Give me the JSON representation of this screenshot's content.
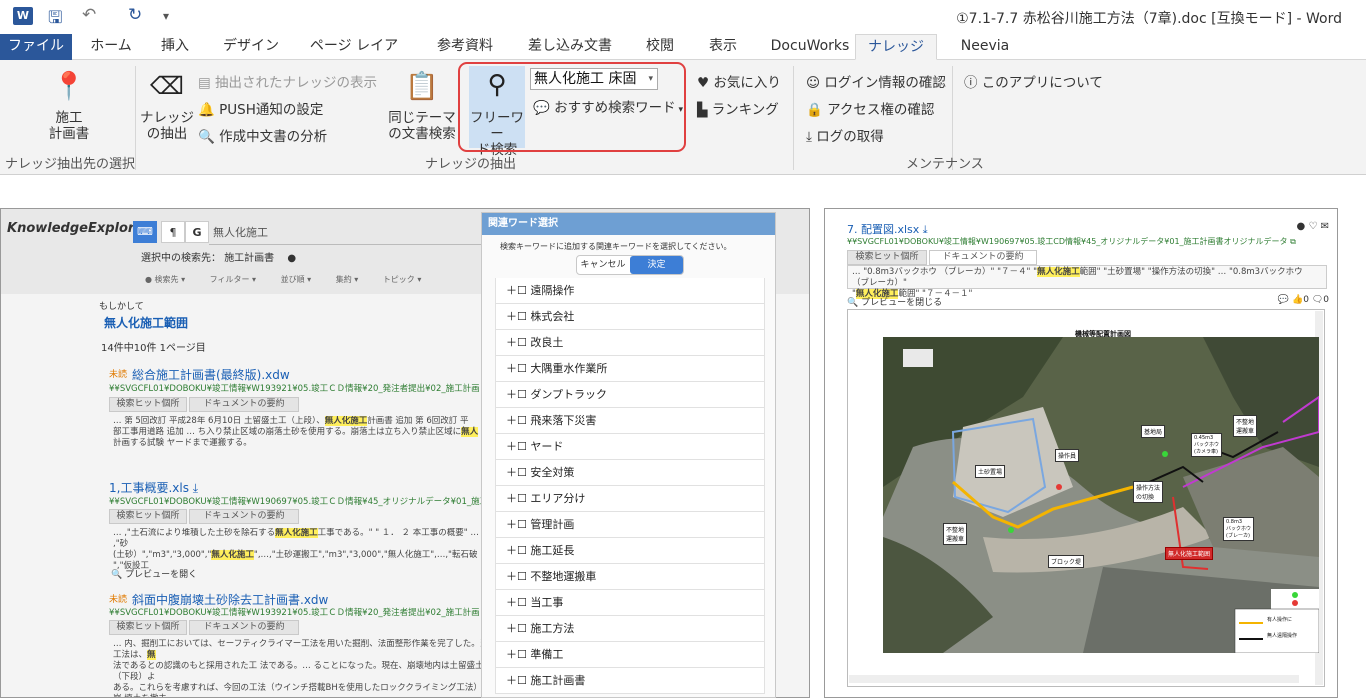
{
  "titlebar": {
    "app_icon": "W",
    "window_title": "①7.1-7.7 赤松谷川施工方法（7章).doc [互換モード] - Word"
  },
  "tabs": [
    "ファイル",
    "ホーム",
    "挿入",
    "デザイン",
    "ページ レイアウト",
    "参考資料",
    "差し込み文書",
    "校閲",
    "表示",
    "DocuWorks",
    "ナレッジ",
    "Neevia"
  ],
  "ribbon": {
    "construction_plan": "施工\n計画書",
    "extract": "ナレッジ\nの抽出",
    "show_extracted": "抽出されたナレッジの表示",
    "push_settings": "PUSH通知の設定",
    "analyze_doc": "作成中文書の分析",
    "same_theme": "同じテーマ\nの文書検索",
    "freeword": "フリーワー\nド検索",
    "search_value": "無人化施工 床固",
    "recommended": "おすすめ検索ワード",
    "favorites": "お気に入り",
    "ranking": "ランキング",
    "login_info": "ログイン情報の確認",
    "access_check": "アクセス権の確認",
    "get_log": "ログの取得",
    "about": "このアプリについて",
    "group_extract_target": "ナレッジ抽出先の選択",
    "group_extract": "ナレッジの抽出",
    "group_maintenance": "メンテナンス"
  },
  "explorer": {
    "logo": "KnowledgeExplorer",
    "search_text": "無人化施工",
    "selected_target_label": "選択中の検索先：",
    "selected_target": "施工計画書",
    "filters": [
      "検索先",
      "フィルター",
      "並び順",
      "集約",
      "トピック"
    ],
    "did_you_mean_label": "もしかして",
    "did_you_mean": "無人化施工範囲",
    "result_count": "14件中10件 1ページ目",
    "hit_tab": "検索ヒット個所",
    "summary_tab": "ドキュメントの要約",
    "preview_open": "プレビューを開く",
    "results": [
      {
        "badge": "未読",
        "title": "総合施工計画書(最終版).xdw",
        "path": "¥¥SVGCFL01¥DOBOKU¥竣工情報¥W193921¥05.竣工ＣＤ情報¥20_発注者提出¥02_施工計画",
        "snippet_a": "… 第 5回改訂 平成28年 6月10日 土留盛土工（上段）、",
        "snippet_hl1": "無人化施工",
        "snippet_b": "計画書 追加 第 6回改訂 平",
        "snippet_2a": "部工事用道路 追加 … ち入り禁止区域の崩落土砂を使用する。崩落土は立ち入り禁止区域に",
        "snippet_hl2": "無人",
        "snippet_3": "計画する試験 ヤードまで運搬する。"
      },
      {
        "badge": "",
        "title": "1,工事概要.xls",
        "path": "¥¥SVGCFL01¥DOBOKU¥竣工情報¥W190697¥05.竣工ＣＤ情報¥45_オリジナルデータ¥01_施工計",
        "snippet_a": "… ,\"土石流により堆積した土砂を除石する",
        "snippet_hl1": "無人化施工",
        "snippet_b": "工事である。\" \" １． ２ 本工事の概要\" … ,\"砂",
        "snippet_2a": "(土砂）\",\"m3\",\"3,000\",\"",
        "snippet_hl2": "無人化施工",
        "snippet_2b": "\",…,\"土砂運搬工\",\"m3\",\"3,000\",\"無人化施工\",…,\"転石破",
        "snippet_3": "\",\"仮設工"
      },
      {
        "badge": "未読",
        "title": "斜面中腹崩壊土砂除去工計画書.xdw",
        "path": "¥¥SVGCFL01¥DOBOKU¥竣工情報¥W193921¥05.竣工ＣＤ情報¥20_発注者提出¥02_施工計画",
        "snippet_a": "… 内、掘削工においては、セーフティクライマー工法を用いた掘削、法面整形作業を完了した。当工法は、",
        "snippet_hl1": "無",
        "snippet_b": "",
        "snippet_2a": "法であるとの認識のもと採用された工 法である。… ることになった。現在、崩壊地内は土留盛土（下段）よ",
        "snippet_hl2": "",
        "snippet_2b": "",
        "snippet_3": "ある。これらを考慮すれば、今回の工法（ウインチ搭載BHを使用したロッククライミング工法）は 崩 壊土を撤去",
        "snippet_4": "施"
      }
    ]
  },
  "dialog": {
    "title": "関連ワード選択",
    "instruction": "検索キーワードに追加する関連キーワードを選択してください。",
    "cancel": "キャンセル",
    "ok": "決定",
    "items": [
      "遠隔操作",
      "株式会社",
      "改良土",
      "大隅重水作業所",
      "ダンプトラック",
      "飛来落下災害",
      "ヤード",
      "安全対策",
      "エリア分け",
      "管理計画",
      "施工延長",
      "不整地運搬車",
      "当工事",
      "施工方法",
      "準備工",
      "施工計画書"
    ]
  },
  "preview": {
    "title": "7. 配置図.xlsx",
    "path": "¥¥SVGCFL01¥DOBOKU¥竣工情報¥W190697¥05.竣工CD情報¥45_オリジナルデータ¥01_施工計画書オリジナルデータ",
    "hit_tab": "検索ヒット個所",
    "summary_tab": "ドキュメントの要約",
    "snip_a": "… \"0.8m3バックホウ （ブレーカ）\" \"７－４\" \"",
    "snip_hl1": "無人化施工",
    "snip_b": "範囲\" \"土砂置場\" \"操作方法の切換\" … \"0.8m3バックホウ （ブレーカ）\"",
    "snip_c": "\"",
    "snip_hl2": "無人化施工",
    "snip_d": "範囲\" \"７－４－１\"",
    "close_preview": "プレビューを閉じる",
    "comment_count": "0",
    "like_count": "0",
    "map_title": "機械等配置計画図",
    "map_labels": {
      "soil": "土砂置場",
      "operator1": "操作員",
      "operator2": "基地局",
      "switch": "操作方法\nの切換",
      "bh45": "0.45m3\nバックホウ\n(カメラ車)",
      "bh08": "0.8m3\nバックホウ\n(ブレーカ)",
      "unmanned": "無人化施工範囲",
      "block": "ブロック堤",
      "kiki1": "不整地\n運搬車",
      "kiki2": "不整地\n運搬車",
      "legend1": "有人操作に",
      "legend2": "無人遠隔操作"
    }
  }
}
